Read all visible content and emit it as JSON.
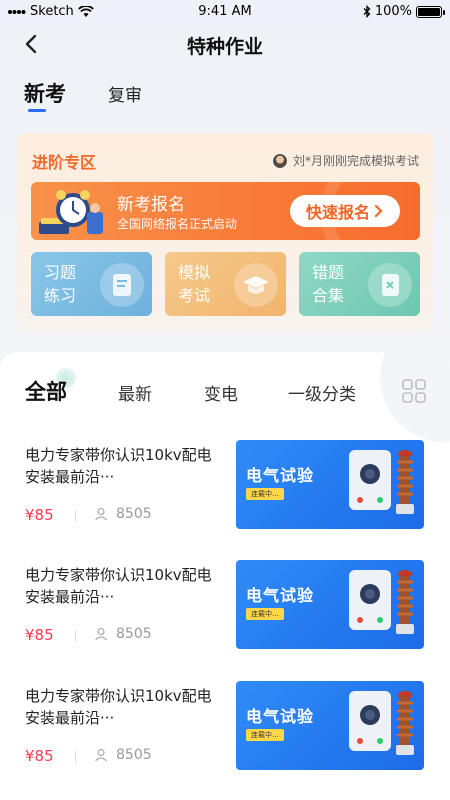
{
  "status_bar": {
    "carrier": "Sketch",
    "time": "9:41 AM",
    "battery": "100%",
    "battery_level": 1.0
  },
  "nav": {
    "title": "特种作业"
  },
  "tabs": [
    {
      "label": "新考",
      "active": true
    },
    {
      "label": "复审",
      "active": false
    }
  ],
  "zone": {
    "title": "进阶专区",
    "notice": "刘*月刚刚完成模拟考试",
    "banner": {
      "title": "新考报名",
      "subtitle": "全国网络报名正式启动",
      "button": "快速报名"
    },
    "cards": [
      {
        "label": "习题练习",
        "icon": "document-icon"
      },
      {
        "label": "模拟考试",
        "icon": "graduation-cap-icon"
      },
      {
        "label": "错题合集",
        "icon": "error-notebook-icon"
      }
    ]
  },
  "categories": {
    "all": "全部",
    "latest": "最新",
    "substation": "变电",
    "level1": "一级分类"
  },
  "courses": [
    {
      "title": "电力专家带你认识10kv配电安装最前沿···",
      "price": "¥85",
      "views": "8505",
      "thumb_title": "电气试验",
      "thumb_badge": "连载中..."
    },
    {
      "title": "电力专家带你认识10kv配电安装最前沿···",
      "price": "¥85",
      "views": "8505",
      "thumb_title": "电气试验",
      "thumb_badge": "连载中..."
    },
    {
      "title": "电力专家带你认识10kv配电安装最前沿···",
      "price": "¥85",
      "views": "8505",
      "thumb_title": "电气试验",
      "thumb_badge": "连载中..."
    }
  ],
  "colors": {
    "accent": "#2a6cf5",
    "zone_title": "#f0692a",
    "price": "#f43d4f",
    "banner": "#f97a38"
  }
}
